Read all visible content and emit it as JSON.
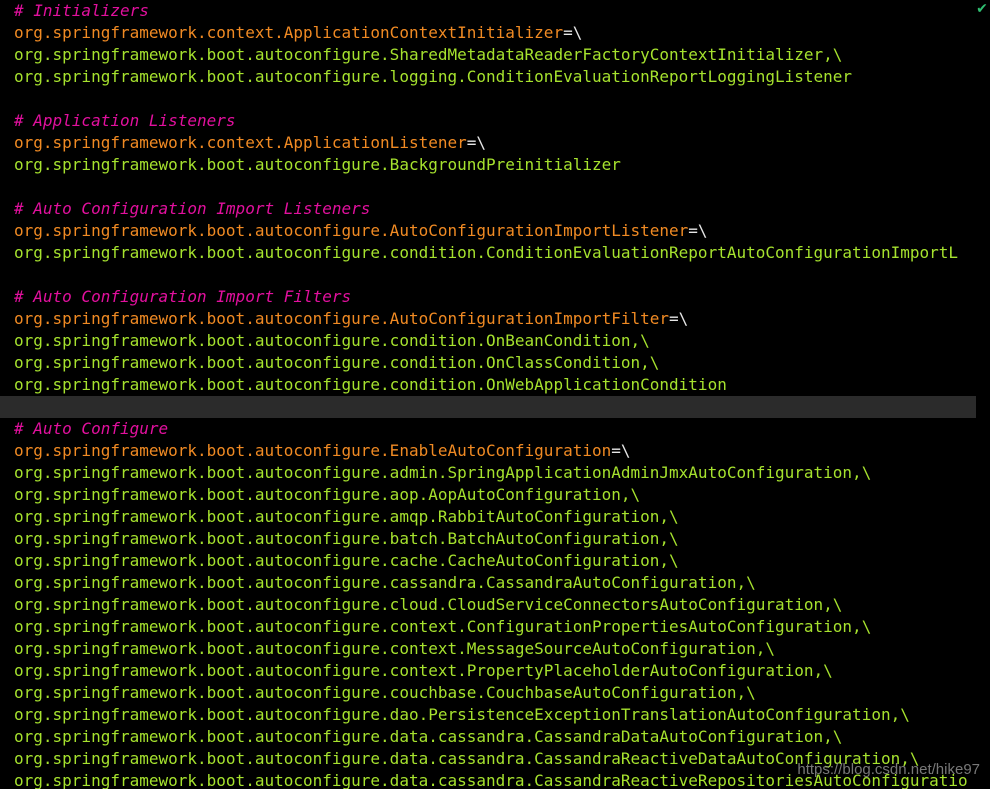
{
  "editor": {
    "status_icon": "check-icon",
    "status_glyph": "✔"
  },
  "lines": [
    {
      "segs": [
        {
          "t": "# Initializers",
          "c": "comment"
        }
      ]
    },
    {
      "segs": [
        {
          "t": "org.springframework.context.ApplicationContextInitializer",
          "c": "key"
        },
        {
          "t": "=\\",
          "c": "plain"
        }
      ]
    },
    {
      "segs": [
        {
          "t": "org.springframework.boot.autoconfigure.SharedMetadataReaderFactoryContextInitializer,\\",
          "c": "val"
        }
      ]
    },
    {
      "segs": [
        {
          "t": "org.springframework.boot.autoconfigure.logging.ConditionEvaluationReportLoggingListener",
          "c": "val"
        }
      ]
    },
    {
      "segs": [
        {
          "t": "",
          "c": "plain"
        }
      ]
    },
    {
      "segs": [
        {
          "t": "# Application Listeners",
          "c": "comment"
        }
      ]
    },
    {
      "segs": [
        {
          "t": "org.springframework.context.ApplicationListener",
          "c": "key"
        },
        {
          "t": "=\\",
          "c": "plain"
        }
      ]
    },
    {
      "segs": [
        {
          "t": "org.springframework.boot.autoconfigure.BackgroundPreinitializer",
          "c": "val"
        }
      ]
    },
    {
      "segs": [
        {
          "t": "",
          "c": "plain"
        }
      ]
    },
    {
      "segs": [
        {
          "t": "# Auto Configuration Import Listeners",
          "c": "comment"
        }
      ]
    },
    {
      "segs": [
        {
          "t": "org.springframework.boot.autoconfigure.AutoConfigurationImportListener",
          "c": "key"
        },
        {
          "t": "=\\",
          "c": "plain"
        }
      ]
    },
    {
      "segs": [
        {
          "t": "org.springframework.boot.autoconfigure.condition.ConditionEvaluationReportAutoConfigurationImportL",
          "c": "val"
        }
      ]
    },
    {
      "segs": [
        {
          "t": "",
          "c": "plain"
        }
      ]
    },
    {
      "segs": [
        {
          "t": "# Auto Configuration Import Filters",
          "c": "comment"
        }
      ]
    },
    {
      "segs": [
        {
          "t": "org.springframework.boot.autoconfigure.AutoConfigurationImportFilter",
          "c": "key"
        },
        {
          "t": "=\\",
          "c": "plain"
        }
      ]
    },
    {
      "segs": [
        {
          "t": "org.springframework.boot.autoconfigure.condition.OnBeanCondition,\\",
          "c": "val"
        }
      ]
    },
    {
      "segs": [
        {
          "t": "org.springframework.boot.autoconfigure.condition.OnClassCondition,\\",
          "c": "val"
        }
      ]
    },
    {
      "segs": [
        {
          "t": "org.springframework.boot.autoconfigure.condition.OnWebApplicationCondition",
          "c": "val"
        }
      ]
    },
    {
      "segs": [
        {
          "t": "",
          "c": "plain"
        }
      ],
      "current": true
    },
    {
      "segs": [
        {
          "t": "# Auto Configure",
          "c": "comment"
        }
      ]
    },
    {
      "segs": [
        {
          "t": "org.springframework.boot.autoconfigure.EnableAutoConfiguration",
          "c": "key"
        },
        {
          "t": "=\\",
          "c": "plain"
        }
      ]
    },
    {
      "segs": [
        {
          "t": "org.springframework.boot.autoconfigure.admin.SpringApplicationAdminJmxAutoConfiguration,\\",
          "c": "val"
        }
      ]
    },
    {
      "segs": [
        {
          "t": "org.springframework.boot.autoconfigure.aop.AopAutoConfiguration,\\",
          "c": "val"
        }
      ]
    },
    {
      "segs": [
        {
          "t": "org.springframework.boot.autoconfigure.amqp.RabbitAutoConfiguration,\\",
          "c": "val"
        }
      ]
    },
    {
      "segs": [
        {
          "t": "org.springframework.boot.autoconfigure.batch.BatchAutoConfiguration,\\",
          "c": "val"
        }
      ]
    },
    {
      "segs": [
        {
          "t": "org.springframework.boot.autoconfigure.cache.CacheAutoConfiguration,\\",
          "c": "val"
        }
      ]
    },
    {
      "segs": [
        {
          "t": "org.springframework.boot.autoconfigure.cassandra.CassandraAutoConfiguration,\\",
          "c": "val"
        }
      ]
    },
    {
      "segs": [
        {
          "t": "org.springframework.boot.autoconfigure.cloud.CloudServiceConnectorsAutoConfiguration,\\",
          "c": "val"
        }
      ]
    },
    {
      "segs": [
        {
          "t": "org.springframework.boot.autoconfigure.context.ConfigurationPropertiesAutoConfiguration,\\",
          "c": "val"
        }
      ]
    },
    {
      "segs": [
        {
          "t": "org.springframework.boot.autoconfigure.context.MessageSourceAutoConfiguration,\\",
          "c": "val"
        }
      ]
    },
    {
      "segs": [
        {
          "t": "org.springframework.boot.autoconfigure.context.PropertyPlaceholderAutoConfiguration,\\",
          "c": "val"
        }
      ]
    },
    {
      "segs": [
        {
          "t": "org.springframework.boot.autoconfigure.couchbase.CouchbaseAutoConfiguration,\\",
          "c": "val"
        }
      ]
    },
    {
      "segs": [
        {
          "t": "org.springframework.boot.autoconfigure.dao.PersistenceExceptionTranslationAutoConfiguration,\\",
          "c": "val"
        }
      ]
    },
    {
      "segs": [
        {
          "t": "org.springframework.boot.autoconfigure.data.cassandra.CassandraDataAutoConfiguration,\\",
          "c": "val"
        }
      ]
    },
    {
      "segs": [
        {
          "t": "org.springframework.boot.autoconfigure.data.cassandra.CassandraReactiveDataAutoConfiguration,\\",
          "c": "val"
        }
      ]
    },
    {
      "segs": [
        {
          "t": "org.springframework.boot.autoconfigure.data.cassandra.CassandraReactiveRepositoriesAutoConfiguratio",
          "c": "val"
        }
      ]
    }
  ],
  "watermark": "https://blog.csdn.net/hike97",
  "colors": {
    "background": "#000000",
    "comment": "#e2109e",
    "key": "#f08a23",
    "value": "#a6e22e",
    "plain": "#e6e6e6",
    "current_line": "#2b2b2b",
    "status_ok": "#2fbf71"
  }
}
